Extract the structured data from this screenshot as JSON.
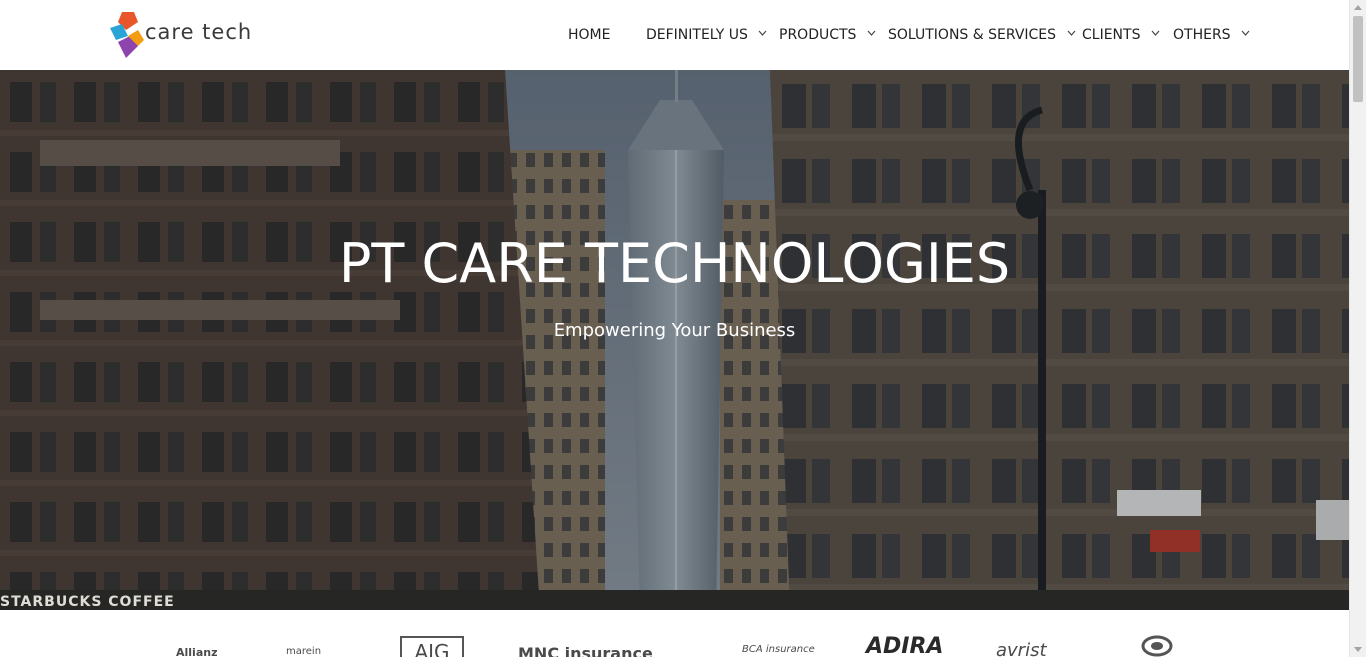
{
  "brand": {
    "name": "care tech",
    "logo_colors": [
      "#e8562a",
      "#2aa3d6",
      "#8e44ad",
      "#f39c12"
    ]
  },
  "nav": {
    "items": [
      {
        "label": "HOME",
        "dropdown": false
      },
      {
        "label": "DEFINITELY US",
        "dropdown": true
      },
      {
        "label": "PRODUCTS",
        "dropdown": true
      },
      {
        "label": "SOLUTIONS & SERVICES",
        "dropdown": true
      },
      {
        "label": "CLIENTS",
        "dropdown": true
      },
      {
        "label": "OTHERS",
        "dropdown": true
      }
    ]
  },
  "hero": {
    "title": "PT CARE TECHNOLOGIES",
    "subtitle": "Empowering Your Business",
    "sign_text": "STARBUCKS COFFEE"
  },
  "clients": {
    "logos": [
      "Allianz",
      "marein",
      "AIG",
      "MNC insurance",
      "BCA insurance",
      "ADIRA",
      "avrist",
      "logo-8"
    ]
  },
  "colors": {
    "nav_text": "#222222",
    "hero_text": "#ffffff",
    "background": "#ffffff"
  }
}
